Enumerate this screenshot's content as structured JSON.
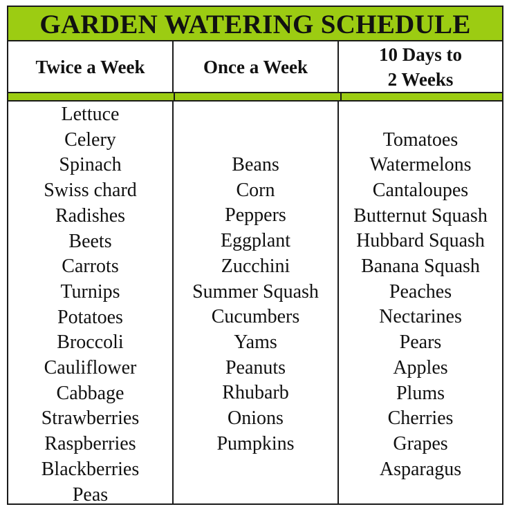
{
  "title": "GARDEN WATERING SCHEDULE",
  "colors": {
    "accent_green": "#9ccc12",
    "border": "#1a1a1a"
  },
  "columns": [
    {
      "header": [
        "Twice a Week"
      ],
      "items": [
        "Lettuce",
        "Celery",
        "Spinach",
        "Swiss chard",
        "Radishes",
        "Beets",
        "Carrots",
        "Turnips",
        "Potatoes",
        "Broccoli",
        "Cauliflower",
        "Cabbage",
        "Strawberries",
        "Raspberries",
        "Blackberries",
        "Peas"
      ]
    },
    {
      "header": [
        "Once a Week"
      ],
      "items": [
        "Beans",
        "Corn",
        "Peppers",
        "Eggplant",
        "Zucchini",
        "Summer Squash",
        "Cucumbers",
        "Yams",
        "Peanuts",
        "Rhubarb",
        "Onions",
        "Pumpkins"
      ]
    },
    {
      "header": [
        "10 Days to",
        "2 Weeks"
      ],
      "items": [
        "Tomatoes",
        "Watermelons",
        "Cantaloupes",
        "Butternut Squash",
        "Hubbard Squash",
        "Banana Squash",
        "Peaches",
        "Nectarines",
        "Pears",
        "Apples",
        "Plums",
        "Cherries",
        "Grapes",
        "Asparagus"
      ]
    }
  ]
}
